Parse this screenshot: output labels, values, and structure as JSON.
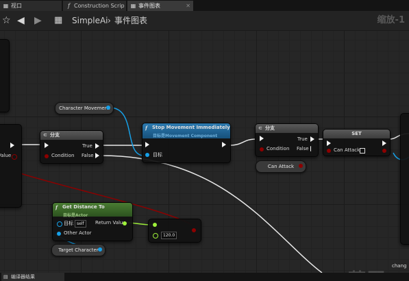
{
  "tabs": [
    {
      "label": "视口",
      "icon": "viewport-icon"
    },
    {
      "label": "Construction Scrip",
      "icon": "function-icon"
    },
    {
      "label": "事件图表",
      "icon": "graph-icon"
    }
  ],
  "toolbar": {
    "breadcrumb_root": "SimpleAi",
    "breadcrumb_separator": "›",
    "breadcrumb_current": "事件图表",
    "zoom": "缩放-1"
  },
  "nodes": {
    "left_partial_value": "Value",
    "character_movement": "Character Movement",
    "branch1": {
      "title": "分支",
      "condition": "Condition",
      "true_label": "True",
      "false_label": "False"
    },
    "stop_movement": {
      "title": "Stop Movement Immediately",
      "subtitle": "目标是Movement Component",
      "target_label": "目标"
    },
    "branch2": {
      "title": "分支",
      "condition": "Condition",
      "true_label": "True",
      "false_label": "False"
    },
    "can_attack_var": "Can Attack",
    "set": {
      "title": "SET",
      "var_label": "Can Attack"
    },
    "get_distance": {
      "title": "Get Distance To",
      "subtitle": "目标是Actor",
      "target_label": "目标",
      "self_value": "self",
      "return_label": "Return Value",
      "other_actor": "Other Actor"
    },
    "compare": {
      "value": "120.0"
    },
    "target_character": "Target Character"
  },
  "bottom": {
    "tab_label": "编译器结果"
  },
  "watermark": {
    "text": "蓝图",
    "small": "chang"
  },
  "colors": {
    "exec": "#f2f2f2",
    "bool": "#8c0000",
    "object": "#00a8f4",
    "float": "#9ef03a",
    "function_header": "#1d5f8a",
    "pure_header": "#3f6b2a"
  }
}
